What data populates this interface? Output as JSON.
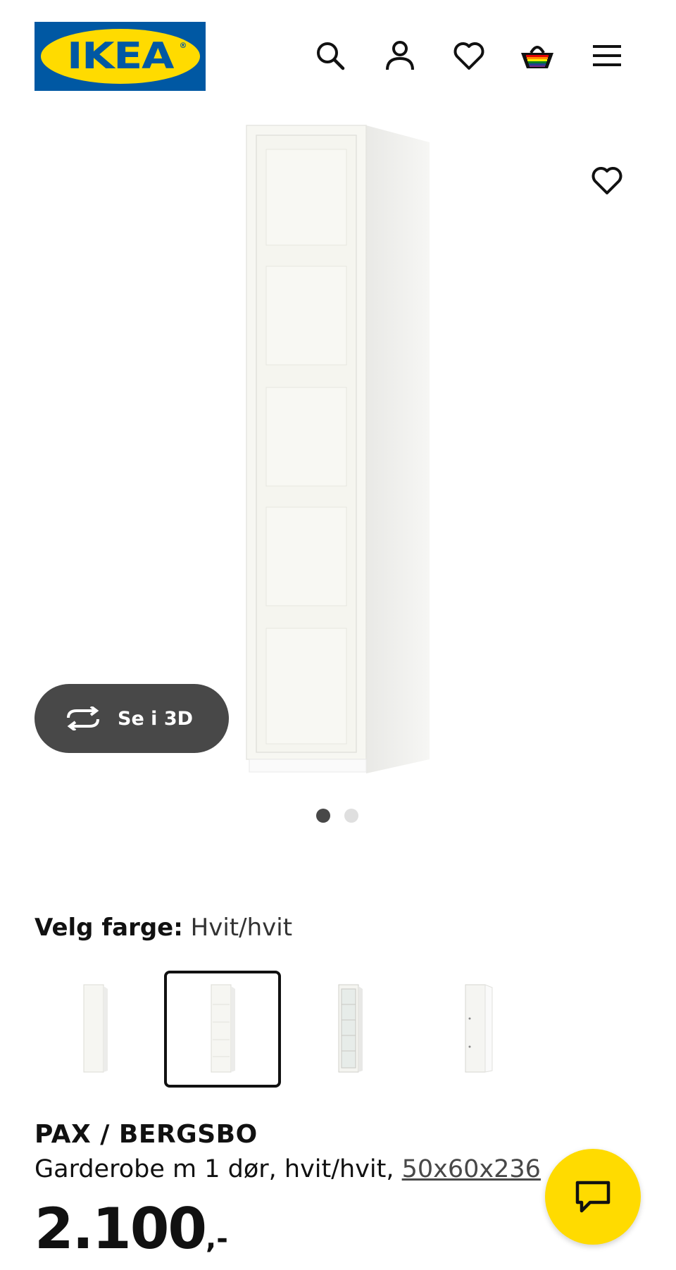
{
  "header": {
    "logo_text": "IKEA",
    "logo_reg": "®",
    "icons": [
      "search-icon",
      "profile-icon",
      "heart-icon",
      "basket-icon",
      "menu-icon"
    ]
  },
  "gallery": {
    "see_3d_label": "Se i 3D",
    "dots": {
      "count": 2,
      "active": 0
    },
    "favorite_icon": "heart-icon"
  },
  "color_picker": {
    "label": "Velg farge:",
    "selected_value": "Hvit/hvit",
    "swatches": [
      {
        "name": "swatch-white-door"
      },
      {
        "name": "swatch-white-white",
        "selected": true
      },
      {
        "name": "swatch-glass-door"
      },
      {
        "name": "swatch-frame-only"
      }
    ]
  },
  "product": {
    "name": "PAX / BERGSBO",
    "description": "Garderobe m 1 dør, hvit/hvit, ",
    "dimensions": "50x60x236",
    "price": "2.100",
    "price_suffix": ",-"
  },
  "colors": {
    "ikea_blue": "#0058a3",
    "ikea_yellow": "#ffdb00",
    "button_dark": "#484848"
  }
}
